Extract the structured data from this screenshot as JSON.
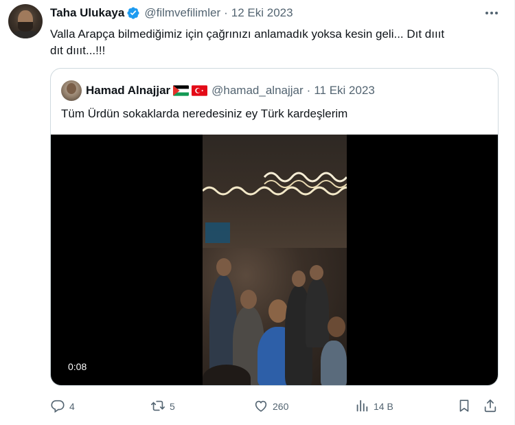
{
  "author": {
    "name": "Taha Ulukaya",
    "handle": "@filmvefilimler",
    "separator": "·",
    "date": "12 Eki 2023",
    "verified": true
  },
  "tweet": {
    "text_line1": "Valla Arapça bilmediğimiz için çağrınızı anlamadık yoksa kesin geli... Dıt dıııt",
    "text_line2": "dıt dıııt...!!!"
  },
  "quoted": {
    "name": "Hamad Alnajjar",
    "flags": [
      "palestine-flag",
      "turkey-flag"
    ],
    "handle": "@hamad_alnajjar",
    "separator": "·",
    "date": "11 Eki 2023",
    "text": "Tüm Ürdün sokaklarda neredesiniz ey Türk kardeşlerim",
    "video": {
      "duration": "0:08"
    }
  },
  "actions": {
    "reply": {
      "icon": "reply-icon",
      "count": "4"
    },
    "retweet": {
      "icon": "retweet-icon",
      "count": "5"
    },
    "like": {
      "icon": "heart-icon",
      "count": "260"
    },
    "views": {
      "icon": "views-icon",
      "count": "14 B"
    },
    "bookmark": {
      "icon": "bookmark-icon"
    },
    "share": {
      "icon": "share-icon"
    }
  },
  "colors": {
    "text": "#0f1419",
    "secondary": "#536471",
    "verified": "#1d9bf0",
    "border": "#cfd9de"
  }
}
